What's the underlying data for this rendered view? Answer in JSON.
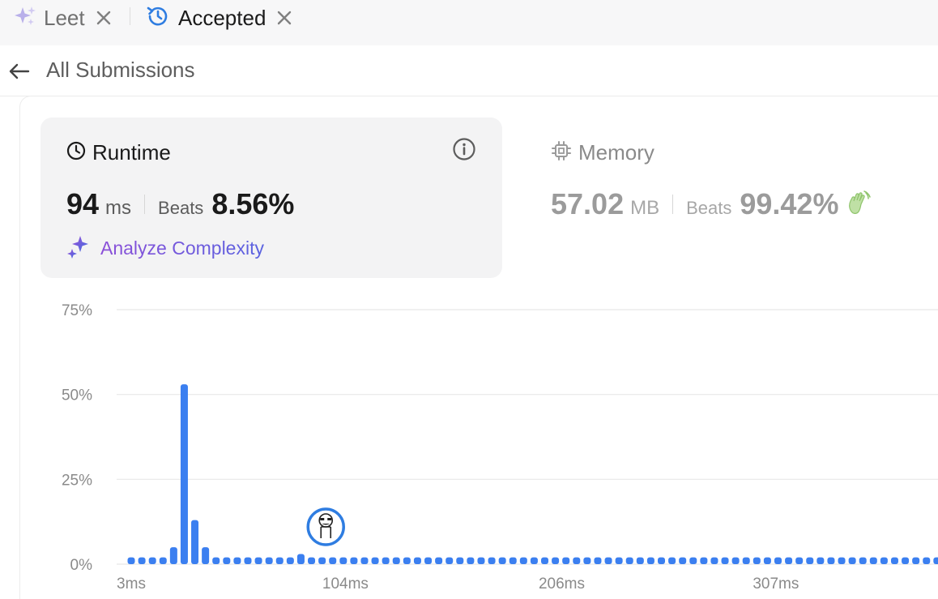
{
  "tabs": [
    {
      "label": "Leet",
      "icon": "sparkle-icon",
      "active": false
    },
    {
      "label": "Accepted",
      "icon": "history-icon",
      "active": true
    }
  ],
  "back": {
    "label": "All Submissions",
    "icon": "arrow-left-icon"
  },
  "runtime": {
    "title": "Runtime",
    "value": "94",
    "unit": "ms",
    "beats_label": "Beats",
    "beats_value": "8.56%",
    "analyze_label": "Analyze Complexity"
  },
  "memory": {
    "title": "Memory",
    "value": "57.02",
    "unit": "MB",
    "beats_label": "Beats",
    "beats_value": "99.42%"
  },
  "colors": {
    "bar": "#3b7ff0",
    "accent_purple": "#8b4fd8",
    "grid": "#e8e8e8"
  },
  "chart_data": {
    "type": "bar",
    "ylim": [
      0,
      75
    ],
    "yticks": [
      "75%",
      "50%",
      "25%",
      "0%"
    ],
    "xticks": [
      "3ms",
      "104ms",
      "206ms",
      "307ms"
    ],
    "grid": true,
    "marker_at_ms": 94,
    "x_ms": [
      3,
      8,
      13,
      18,
      23,
      28,
      33,
      38,
      43,
      48,
      53,
      58,
      63,
      68,
      73,
      78,
      83,
      88,
      93,
      98,
      103,
      108,
      113,
      118,
      123,
      128,
      133,
      138,
      143,
      148,
      153,
      158,
      163,
      168,
      173,
      178,
      183,
      188,
      193,
      198,
      203,
      208,
      213,
      218,
      223,
      228,
      233,
      238,
      243,
      248,
      253,
      258,
      263,
      268,
      273,
      278,
      283,
      288,
      293,
      298,
      303,
      308,
      313,
      318,
      323,
      328,
      333,
      338,
      343,
      348,
      353,
      358,
      363,
      368,
      373,
      378,
      383,
      388,
      393
    ],
    "values": [
      2,
      2,
      2,
      2,
      5,
      53,
      13,
      5,
      2,
      2,
      2,
      2,
      2,
      2,
      2,
      2,
      3,
      2,
      2,
      2,
      2,
      2,
      2,
      2,
      2,
      2,
      2,
      2,
      2,
      2,
      2,
      2,
      2,
      2,
      2,
      2,
      2,
      2,
      2,
      2,
      2,
      2,
      2,
      2,
      2,
      2,
      2,
      2,
      2,
      2,
      2,
      2,
      2,
      2,
      2,
      2,
      2,
      2,
      2,
      2,
      2,
      2,
      2,
      2,
      2,
      2,
      2,
      2,
      2,
      2,
      2,
      2,
      2,
      2,
      2,
      2,
      2,
      2,
      2
    ]
  }
}
